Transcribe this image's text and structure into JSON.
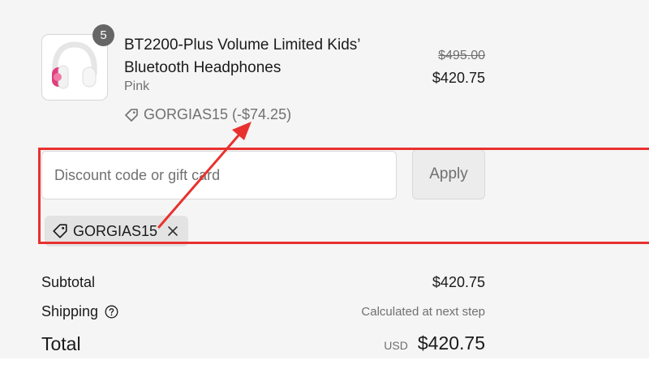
{
  "product": {
    "quantity": "5",
    "title": "BT2200-Plus Volume Limited Kids’ Bluetooth Headphones",
    "variant": "Pink",
    "compare_price": "$495.00",
    "price": "$420.75",
    "discount_label": "GORGIAS15 (-$74.25)",
    "image_icon": "headphones-image"
  },
  "discount_form": {
    "placeholder": "Discount code or gift card",
    "value": "",
    "apply_label": "Apply",
    "applied_code": "GORGIAS15"
  },
  "summary": {
    "subtotal_label": "Subtotal",
    "subtotal_value": "$420.75",
    "shipping_label": "Shipping",
    "shipping_value": "Calculated at next step",
    "total_label": "Total",
    "currency": "USD",
    "total_value": "$420.75"
  },
  "annotation": {
    "color": "#e8312f"
  },
  "colors": {
    "background": "#f5f5f5",
    "text": "#1a1a1a",
    "muted": "#707070",
    "chip": "#e3e3e3",
    "headphone_pink": "#e0407e"
  }
}
